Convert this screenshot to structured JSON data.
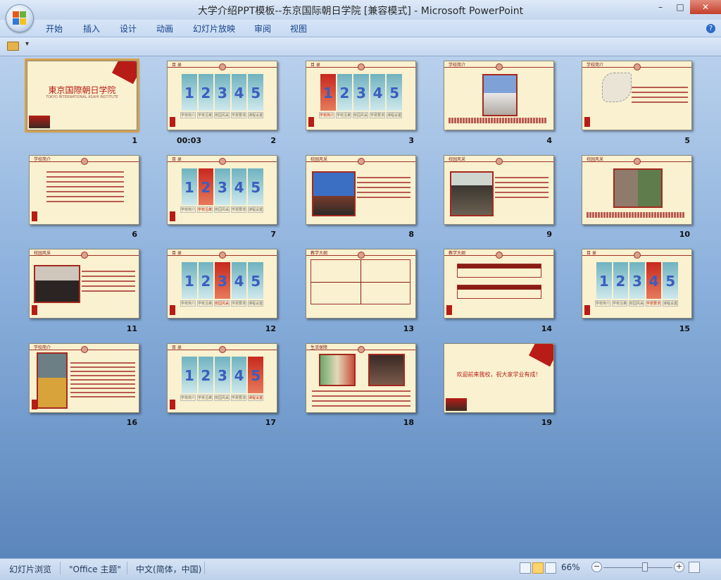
{
  "window": {
    "title": "大学介绍PPT模板--东京国际朝日学院 [兼容模式] - Microsoft PowerPoint",
    "minimize": "–",
    "maximize": "□",
    "close": "✕"
  },
  "ribbon": {
    "tabs": [
      "开始",
      "插入",
      "设计",
      "动画",
      "幻灯片放映",
      "审阅",
      "视图"
    ],
    "help": "?"
  },
  "qat": {
    "dropdown": "▾"
  },
  "slides": {
    "timing_label": "00:03",
    "numbers": [
      "1",
      "2",
      "3",
      "4",
      "5",
      "6",
      "7",
      "8",
      "9",
      "10",
      "11",
      "12",
      "13",
      "14",
      "15",
      "16",
      "17",
      "18",
      "19"
    ],
    "s1": {
      "title": "東京国際朝日学院",
      "subtitle": "TOKYO INTERNATIONAL ASAHI INSTITUTE"
    },
    "s19": {
      "text": "欢迎前来我校，祝大家学业有成！"
    },
    "tile_digits": [
      "1",
      "2",
      "3",
      "4",
      "5"
    ],
    "tile_labels": [
      "学校简介",
      "学校沿革",
      "校园风采",
      "学费要求",
      "课程设置"
    ],
    "headers": {
      "toc": "目 录",
      "intro": "学校简介",
      "campus": "校园风采",
      "tuition": "教学大纲",
      "life": "生活保障"
    }
  },
  "status": {
    "view_name": "幻灯片浏览",
    "theme": "\"Office 主题\"",
    "language": "中文(简体，中国)",
    "zoom": "66%",
    "zoom_out": "−",
    "zoom_in": "+"
  }
}
